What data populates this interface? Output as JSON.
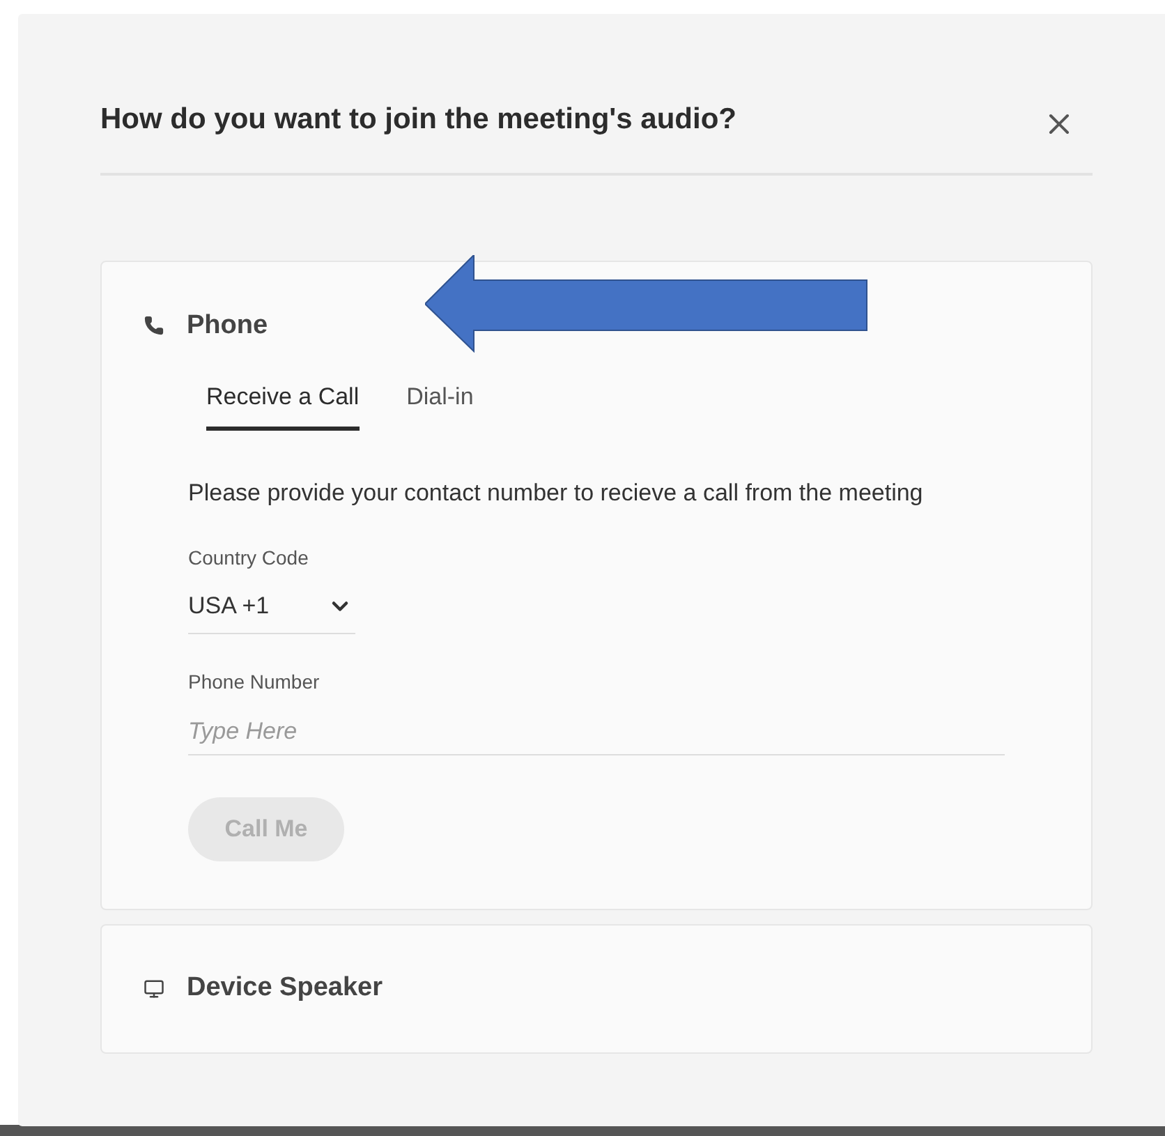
{
  "dialog": {
    "title": "How do you want to join the meeting's audio?",
    "sections": [
      {
        "kind": "phone",
        "title": "Phone",
        "expanded": true,
        "tabs": [
          {
            "label": "Receive a Call",
            "selected": true
          },
          {
            "label": "Dial-in",
            "selected": false
          }
        ],
        "instructions": "Please provide your contact number to recieve a call from the meeting",
        "country_code": {
          "label": "Country Code",
          "value": "USA +1"
        },
        "phone_number": {
          "label": "Phone Number",
          "placeholder": "Type Here"
        },
        "call_button": {
          "label": "Call Me",
          "disabled": true
        }
      },
      {
        "kind": "speaker",
        "title": "Device Speaker",
        "expanded": false
      }
    ]
  }
}
